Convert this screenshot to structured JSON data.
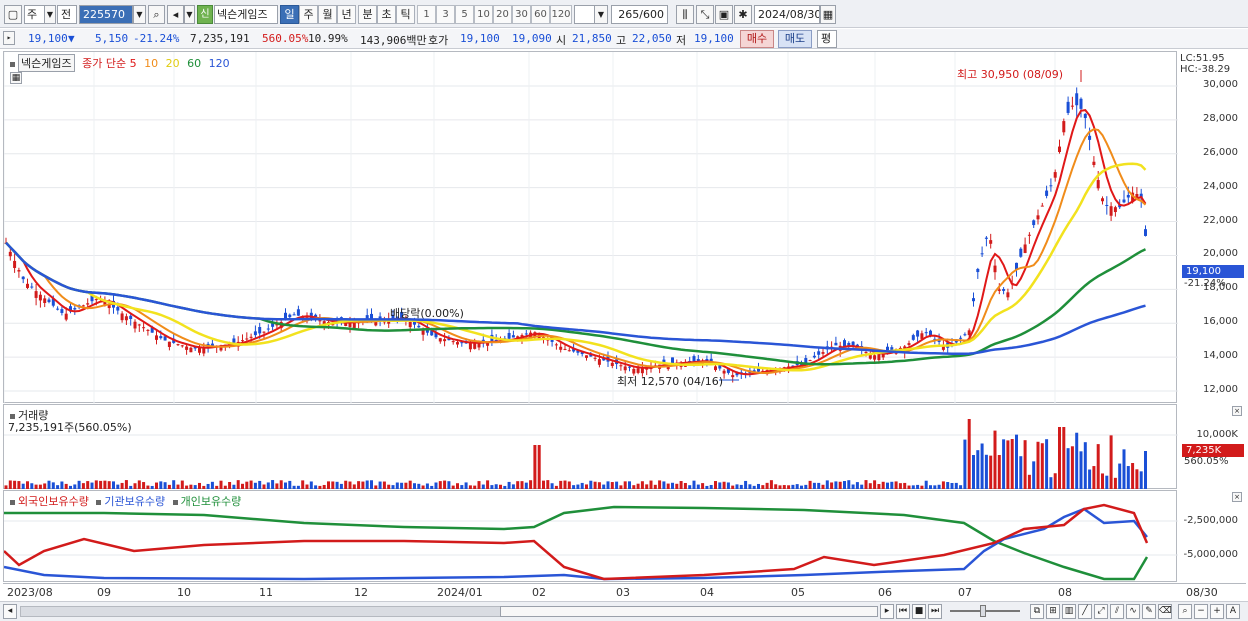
{
  "toolbar": {
    "period_type": "주",
    "prev": "전",
    "stock_code": "225570",
    "new_badge": "신",
    "stock_name": "넥슨게임즈",
    "intervals": [
      "일",
      "주",
      "월",
      "년",
      "분",
      "초",
      "틱"
    ],
    "active_interval": "일",
    "numbers": [
      "1",
      "3",
      "5",
      "10",
      "20",
      "30",
      "60",
      "120"
    ],
    "count": "265",
    "count_total": "/600",
    "date": "2024/08/30"
  },
  "quote": {
    "price": "19,100",
    "arrow": "▼",
    "change": "5,150",
    "change_pct": "-21.24%",
    "volume": "7,235,191",
    "volume_pct": "560.05%",
    "turnover": "10.99%",
    "amount": "143,906백만",
    "bid_label": "호가",
    "bid1": "19,100",
    "bid2": "19,090",
    "open_label": "시",
    "open": "21,850",
    "high_label": "고",
    "high": "22,050",
    "low_label": "저",
    "low": "19,100",
    "buy": "매수",
    "sell": "매도",
    "flat": "평"
  },
  "price_panel": {
    "name": "넥슨게임즈",
    "legend_title": "종가 단순",
    "ma": [
      {
        "period": "5",
        "color": "#e01818"
      },
      {
        "period": "10",
        "color": "#f08c1a"
      },
      {
        "period": "20",
        "color": "#f2e21e"
      },
      {
        "period": "60",
        "color": "#1f8f3a"
      },
      {
        "period": "120",
        "color": "#2a55d6"
      }
    ],
    "high_annotation": "최고 30,950 (08/09)",
    "low_annotation": "최저 12,570 (04/16)",
    "dividend_annotation": "배당락(0.00%)",
    "lc": "LC:51.95",
    "hc": "HC:-38.29",
    "current_tag": "19,100",
    "current_pct": "-21.24%",
    "y_ticks": [
      "30,000",
      "28,000",
      "26,000",
      "24,000",
      "22,000",
      "20,000",
      "18,000",
      "16,000",
      "14,000",
      "12,000"
    ]
  },
  "volume_panel": {
    "title": "거래량",
    "value": "7,235,191주(560.05%)",
    "y_tick": "10,000K",
    "current_tag": "7,235K",
    "current_pct": "560.05%"
  },
  "flow_panel": {
    "legend": [
      {
        "label": "외국인보유수량",
        "color": "#d21b1b"
      },
      {
        "label": "기관보유수량",
        "color": "#2a55d6"
      },
      {
        "label": "개인보유수량",
        "color": "#1f8f3a"
      }
    ],
    "y_ticks": [
      "-2,500,000",
      "-5,000,000"
    ]
  },
  "x_axis": {
    "labels": [
      "2023/08",
      "09",
      "10",
      "11",
      "12",
      "2024/01",
      "02",
      "03",
      "04",
      "05",
      "06",
      "07",
      "08"
    ],
    "end_label": "08/30"
  },
  "colors": {
    "up": "#d21b1b",
    "down": "#1a4fd6",
    "accent": "#3b6fb6"
  }
}
